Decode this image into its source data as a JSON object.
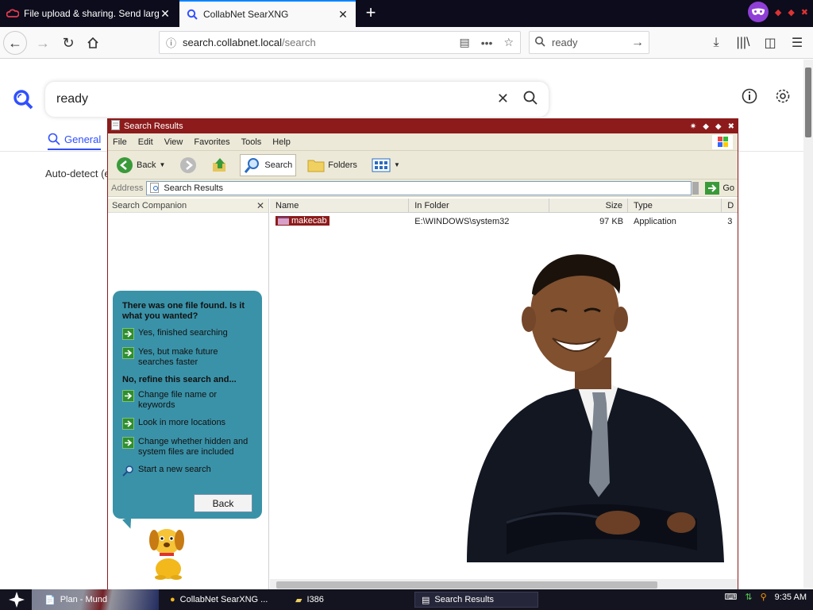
{
  "browser": {
    "tabs": [
      {
        "label": "File upload & sharing. Send large p",
        "active": false
      },
      {
        "label": "CollabNet SearXNG",
        "active": true
      }
    ],
    "url_domain": "search.collabnet.local",
    "url_path": "/search",
    "search_box_value": "ready",
    "accent_color": "#0a84ff"
  },
  "searxng": {
    "query": "ready",
    "tab_general": "General",
    "autodetect_text": "Auto-detect (e",
    "accent_color": "#3050ff"
  },
  "explorer": {
    "title": "Search Results",
    "menu": [
      "File",
      "Edit",
      "View",
      "Favorites",
      "Tools",
      "Help"
    ],
    "toolbar": {
      "back": "Back",
      "search": "Search",
      "folders": "Folders"
    },
    "address_label": "Address",
    "address_value": "Search Results",
    "go_label": "Go",
    "companion_title": "Search Companion",
    "columns": [
      "Name",
      "In Folder",
      "Size",
      "Type",
      "D"
    ],
    "rows": [
      {
        "name": "makecab",
        "folder": "E:\\WINDOWS\\system32",
        "size": "97 KB",
        "type": "Application",
        "date": "3"
      }
    ],
    "bubble": {
      "heading": "There was one file found.  Is it what you wanted?",
      "options_found": [
        "Yes, finished searching",
        "Yes, but make future searches faster"
      ],
      "refine_heading": "No, refine this search and...",
      "options_refine": [
        "Change file name or keywords",
        "Look in more locations",
        "Change whether hidden and system files are included"
      ],
      "new_search": "Start a new search",
      "back_button": "Back"
    },
    "title_color": "#8d1b1b"
  },
  "taskbar": {
    "items": [
      "Plan - Mund",
      "CollabNet SearXNG ...",
      "I386",
      "Search Results"
    ],
    "clock": "9:35 AM"
  }
}
